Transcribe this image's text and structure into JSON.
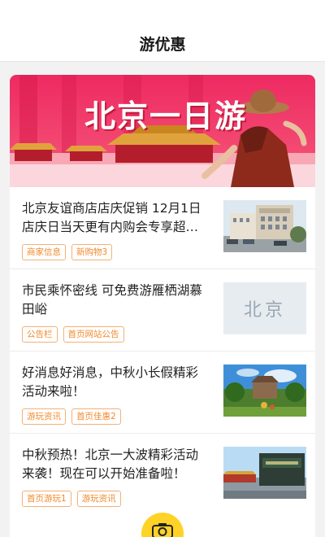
{
  "header": {
    "title": "游优惠"
  },
  "banner": {
    "title": "北京一日游"
  },
  "news": [
    {
      "title": "北京友谊商店店庆促销 12月1日店庆日当天更有内购会专享超…",
      "tags": [
        "商家信息",
        "新购物3"
      ],
      "thumb": "building-photo"
    },
    {
      "title": "市民乘怀密线 可免费游雁栖湖慕田峪",
      "tags": [
        "公告栏",
        "首页网站公告"
      ],
      "thumb": "beijing-logo",
      "thumb_text": "北京"
    },
    {
      "title": "好消息好消息，中秋小长假精彩活动来啦！",
      "tags": [
        "游玩资讯",
        "首页佳惠2"
      ],
      "thumb": "park-photo"
    },
    {
      "title": "中秋预热！北京一大波精彩活动来袭！现在可以开始准备啦！",
      "tags": [
        "首页游玩1",
        "游玩资讯"
      ],
      "thumb": "palace-sign-photo"
    }
  ],
  "fab": {
    "icon": "camera-icon"
  }
}
